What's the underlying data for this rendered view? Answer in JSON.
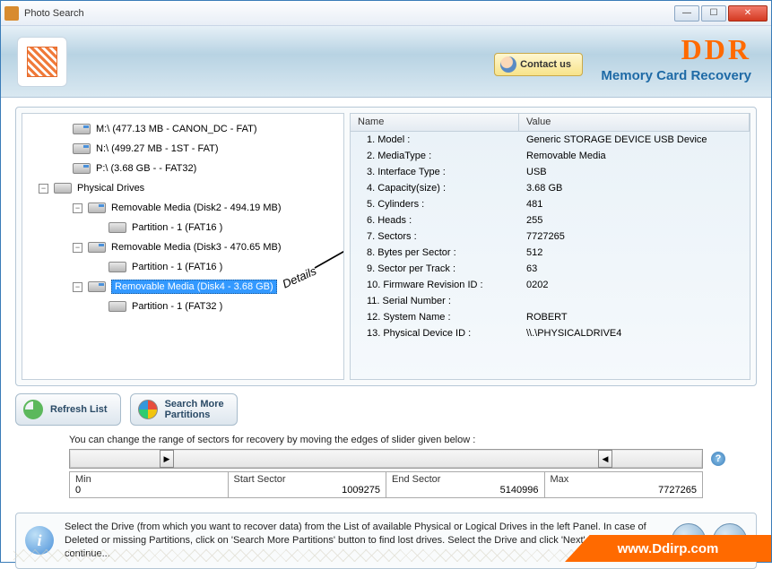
{
  "window": {
    "title": "Photo Search"
  },
  "banner": {
    "contact": "Contact us",
    "brand": "DDR",
    "subtitle": "Memory Card Recovery"
  },
  "tree": {
    "drives": [
      "M:\\ (477.13 MB - CANON_DC - FAT)",
      "N:\\ (499.27 MB - 1ST - FAT)",
      "P:\\ (3.68 GB -  - FAT32)"
    ],
    "physical_label": "Physical Drives",
    "removable": [
      {
        "label": "Removable Media (Disk2 - 494.19 MB)",
        "partition": "Partition - 1 (FAT16 )"
      },
      {
        "label": "Removable Media (Disk3 - 470.65 MB)",
        "partition": "Partition - 1 (FAT16 )"
      },
      {
        "label": "Removable Media (Disk4 - 3.68 GB)",
        "partition": "Partition - 1 (FAT32 )"
      }
    ],
    "details_annotation": "Details"
  },
  "props": {
    "header_name": "Name",
    "header_value": "Value",
    "rows": [
      {
        "n": "1. Model :",
        "v": "Generic STORAGE DEVICE USB Device"
      },
      {
        "n": "2. MediaType :",
        "v": "Removable Media"
      },
      {
        "n": "3. Interface Type :",
        "v": "USB"
      },
      {
        "n": "4. Capacity(size) :",
        "v": "3.68 GB"
      },
      {
        "n": "5. Cylinders :",
        "v": "481"
      },
      {
        "n": "6. Heads :",
        "v": "255"
      },
      {
        "n": "7. Sectors :",
        "v": "7727265"
      },
      {
        "n": "8. Bytes per Sector :",
        "v": "512"
      },
      {
        "n": "9. Sector per Track :",
        "v": "63"
      },
      {
        "n": "10. Firmware Revision ID :",
        "v": "0202"
      },
      {
        "n": "11. Serial Number :",
        "v": ""
      },
      {
        "n": "12. System Name :",
        "v": "ROBERT"
      },
      {
        "n": "13. Physical Device ID :",
        "v": "\\\\.\\PHYSICALDRIVE4"
      }
    ]
  },
  "actions": {
    "refresh": "Refresh List",
    "search_more_l1": "Search More",
    "search_more_l2": "Partitions"
  },
  "slider": {
    "instruction": "You can change the range of sectors for recovery by moving the edges of slider given below :",
    "min_label": "Min",
    "min_val": "0",
    "start_label": "Start Sector",
    "start_val": "1009275",
    "end_label": "End Sector",
    "end_val": "5140996",
    "max_label": "Max",
    "max_val": "7727265"
  },
  "info": {
    "text": "Select the Drive (from which you want to recover data) from the List of available Physical or Logical Drives in the left Panel. In case of Deleted or missing Partitions, click on 'Search More Partitions' button to find lost drives. Select the Drive and click 'Next' Button to continue..."
  },
  "footer_url": "www.Ddirp.com"
}
